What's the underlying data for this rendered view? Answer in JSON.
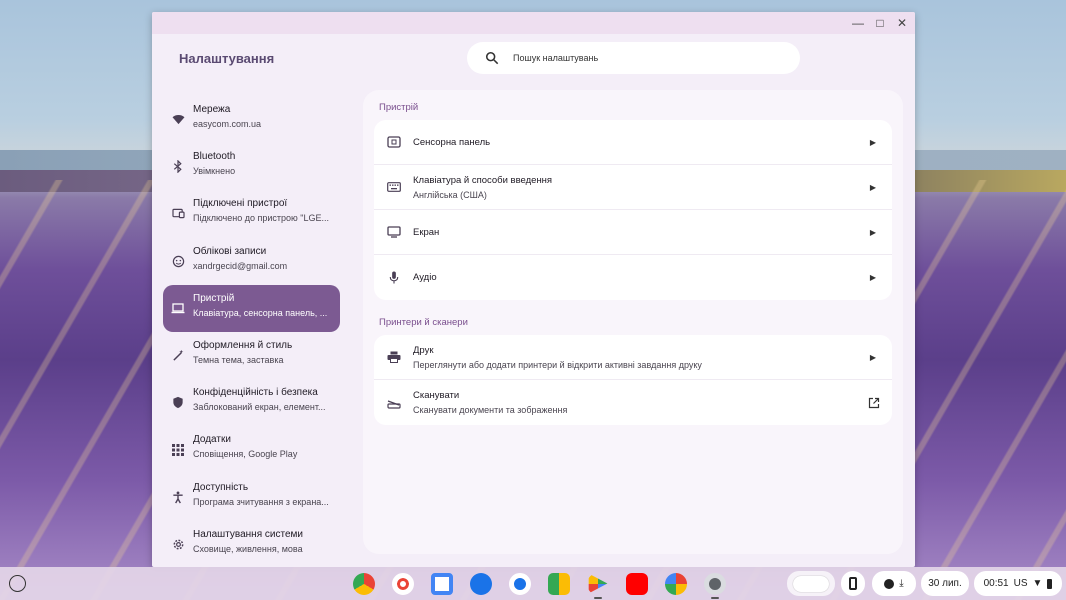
{
  "window": {
    "title": "Налаштування"
  },
  "search": {
    "placeholder": "Пошук налаштувань"
  },
  "sidebar": {
    "items": [
      {
        "title": "Мережа",
        "sub": "easycom.com.ua"
      },
      {
        "title": "Bluetooth",
        "sub": "Увімкнено"
      },
      {
        "title": "Підключені пристрої",
        "sub": "Підключено до пристрою \"LGE..."
      },
      {
        "title": "Облікові записи",
        "sub": "xandrgecid@gmail.com"
      },
      {
        "title": "Пристрій",
        "sub": "Клавіатура, сенсорна панель, ..."
      },
      {
        "title": "Оформлення й стиль",
        "sub": "Темна тема, заставка"
      },
      {
        "title": "Конфіденційність і безпека",
        "sub": "Заблокований екран, елемент..."
      },
      {
        "title": "Додатки",
        "sub": "Сповіщення, Google Play"
      },
      {
        "title": "Доступність",
        "sub": "Програма зчитування з екрана..."
      },
      {
        "title": "Налаштування системи",
        "sub": "Сховище, живлення, мова"
      }
    ]
  },
  "device": {
    "section_title": "Пристрій",
    "rows": [
      {
        "title": "Сенсорна панель",
        "sub": ""
      },
      {
        "title": "Клавіатура й способи введення",
        "sub": "Англійська (США)"
      },
      {
        "title": "Екран",
        "sub": ""
      },
      {
        "title": "Аудіо",
        "sub": ""
      }
    ]
  },
  "printers": {
    "section_title": "Принтери й сканери",
    "rows": [
      {
        "title": "Друк",
        "sub": "Переглянути або додати принтери й відкрити активні завдання друку"
      },
      {
        "title": "Сканувати",
        "sub": "Сканувати документи та зображення"
      }
    ]
  },
  "shelf": {
    "date": "30 лип.",
    "time": "00:51",
    "locale": "US"
  },
  "colors": {
    "accent": "#7c5a92",
    "section": "#7a4f8e",
    "window_bg": "#f4eef8"
  }
}
